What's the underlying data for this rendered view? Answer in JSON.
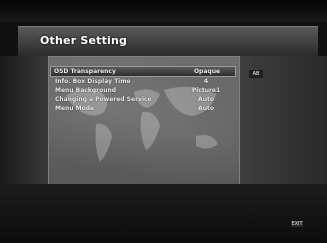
{
  "screen": {
    "title": "Other Setting"
  },
  "menu": {
    "items": [
      {
        "label": "OSD Transparency",
        "value": "Opaque",
        "selected": true
      },
      {
        "label": "Info. Box Display Time",
        "value": "4"
      },
      {
        "label": "Menu Background",
        "value": "Picture1"
      },
      {
        "label": "Changing a Powered Service",
        "value": "Auto"
      },
      {
        "label": "Menu Mode",
        "value": "Auto"
      }
    ]
  },
  "right_panel": {
    "tag": "AB"
  },
  "footer": {
    "icon": "EXIT"
  },
  "colors": {
    "panel": "#666666",
    "highlight": "#2e2e2e",
    "text": "#f0f0f0"
  }
}
